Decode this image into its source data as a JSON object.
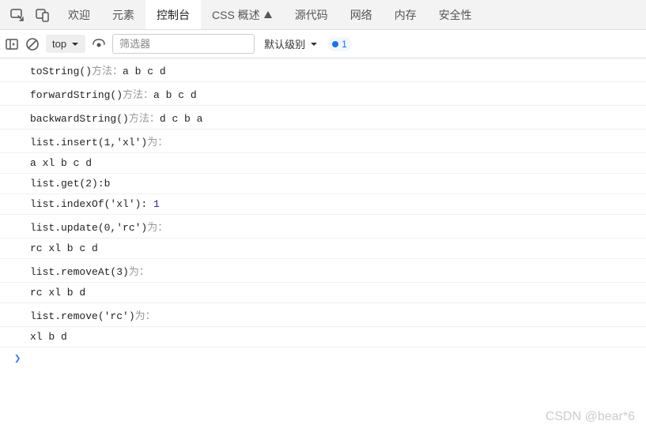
{
  "tabs": {
    "items": [
      {
        "label": "欢迎"
      },
      {
        "label": "元素"
      },
      {
        "label": "控制台"
      },
      {
        "label": "CSS 概述"
      },
      {
        "label": "源代码"
      },
      {
        "label": "网络"
      },
      {
        "label": "内存"
      },
      {
        "label": "安全性"
      }
    ],
    "warnIndex": 3,
    "activeIndex": 2
  },
  "toolbar": {
    "context": "top",
    "filterPlaceholder": "筛选器",
    "levelLabel": "默认级别",
    "issueCount": "1"
  },
  "logs": [
    {
      "segments": [
        {
          "t": "toString()",
          "c": "code"
        },
        {
          "t": "方法：",
          "c": "gray"
        },
        {
          "t": "a b c d",
          "c": "code"
        }
      ]
    },
    {
      "segments": [
        {
          "t": "forwardString()",
          "c": "code"
        },
        {
          "t": "方法：",
          "c": "gray"
        },
        {
          "t": "a b c d",
          "c": "code"
        }
      ]
    },
    {
      "segments": [
        {
          "t": "backwardString()",
          "c": "code"
        },
        {
          "t": "方法：",
          "c": "gray"
        },
        {
          "t": "d c b a",
          "c": "code"
        }
      ]
    },
    {
      "segments": [
        {
          "t": "list.insert(1,'xl')",
          "c": "code"
        },
        {
          "t": "为：",
          "c": "gray"
        }
      ]
    },
    {
      "segments": [
        {
          "t": "a xl b c d",
          "c": "code"
        }
      ]
    },
    {
      "segments": [
        {
          "t": "list.get(2):b",
          "c": "code"
        }
      ]
    },
    {
      "segments": [
        {
          "t": "list.indexOf('xl'): ",
          "c": "code"
        },
        {
          "t": "1",
          "c": "num"
        }
      ]
    },
    {
      "segments": [
        {
          "t": "list.update(0,'rc')",
          "c": "code"
        },
        {
          "t": "为：",
          "c": "gray"
        }
      ]
    },
    {
      "segments": [
        {
          "t": "rc xl b c d",
          "c": "code"
        }
      ]
    },
    {
      "segments": [
        {
          "t": "list.removeAt(3)",
          "c": "code"
        },
        {
          "t": "为：",
          "c": "gray"
        }
      ]
    },
    {
      "segments": [
        {
          "t": "rc xl b d",
          "c": "code"
        }
      ]
    },
    {
      "segments": [
        {
          "t": "list.remove('rc')",
          "c": "code"
        },
        {
          "t": "为：",
          "c": "gray"
        }
      ]
    },
    {
      "segments": [
        {
          "t": "xl b d",
          "c": "code"
        }
      ]
    }
  ],
  "prompt": "❯",
  "watermark": "CSDN @bear*6"
}
